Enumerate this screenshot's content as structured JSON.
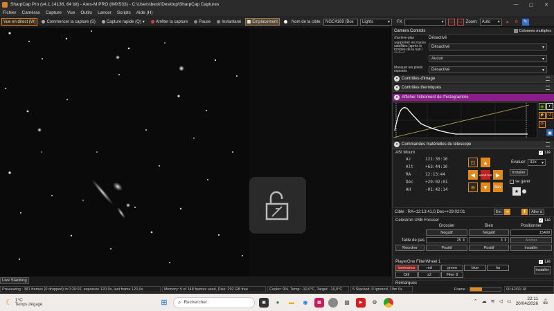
{
  "window": {
    "title": "SharpCap Pro (v4.1.14136, 64 bit) - Ares-M PRO (IMX533) - C:\\Users\\beck\\Desktop\\SharpCap Captures",
    "controls": [
      "—",
      "▢",
      "✕"
    ]
  },
  "menu": [
    "Fichier",
    "Caméras",
    "Capture",
    "Vue",
    "Outils",
    "Lancer",
    "Scripts",
    "Aide (H)"
  ],
  "toolbar": {
    "live_view": "Vue en direct (W)",
    "start_capture": "Commencer la capture (S)",
    "quick_capture": "Capture rapide (Q)",
    "stop_capture": "Arrêter la capture",
    "pause": "Pause",
    "snapshot": "Instantané",
    "placement": "Emplacement",
    "target_label": "Nom de la cible:",
    "target_value": "NGC4169 (Box",
    "frame_type": "Lights",
    "fx_label": "FX",
    "zoom_label": "Zoom:",
    "zoom_value": "Auto"
  },
  "image": {
    "lock_icon": "unlock-icon",
    "live_stacking": "Live Stacking"
  },
  "status": {
    "previewing": "Previewing : 381 frames (0 dropped) in 0:26:02, exposure 120,0s, last frame 120,0s",
    "memory": "Memory: 5 of 148 frames used, Disk: 292 GB free",
    "cooler": "Cooler: 9%, Temp: -10,0°C, Target: -10,0°C",
    "stacked": "5 Stacked, 0 Ignored, 10m 0s",
    "frame_label": "Frame :",
    "time": "00:42/01:18"
  },
  "panel": {
    "camera_controls": "Camera Controls",
    "multi_columns": "Colonnes multiples",
    "cc_rows": [
      {
        "label": "d'arrière-plan",
        "value": "Désactivé"
      },
      {
        "label": "Supprimer les traces satellites (après le tombée de la nuit / étoiles)",
        "value": "Désactivé"
      },
      {
        "label": "",
        "value": "Aucun"
      },
      {
        "label": "Masquer les pixels exposés",
        "value": "Désactivé"
      }
    ],
    "image_controls": "Contrôles d'image",
    "thermal_controls": "Contrôles thermiques",
    "histogram_title": "Afficher l'étirement de l'histogramme",
    "scope_section": "Commandes matérielles du télescope",
    "mount_name": "ASI Mount",
    "linked": "Lié",
    "coords": [
      {
        "k": "Az",
        "v": "121:30:16"
      },
      {
        "k": "Alt",
        "v": "+63:44:10"
      },
      {
        "k": "RA",
        "v": "12:13:44"
      },
      {
        "k": "Déc",
        "v": "+29:02:01"
      },
      {
        "k": "AH",
        "v": "-01:42:14"
      }
    ],
    "speed_label": "Évaluer:",
    "speed_value": "32x",
    "install": "Installer",
    "park": "se garer",
    "stop": "ARRÊTER",
    "follow": "Suiv",
    "target_line": "Cible : RA=12:13:41,0,Dec=+29:02:01",
    "goto_btn": "Em",
    "goto2_btn": "Aller à",
    "focuser_name": "Celestron USB Focuser",
    "focus_coarse": "Grossier",
    "focus_fine": "Bien",
    "focus_position": "Positionner",
    "negative": "Négatif",
    "positive": "Positif",
    "step_label": "Taille de pas",
    "coarse_step": "25",
    "fine_step": "3",
    "position_value": "15499",
    "stop_btn": "Arrêter",
    "reverse": "Reordrer",
    "wheel_name": "PlayerOne FilterWheel 1",
    "filters_row1": [
      "luminance",
      "red",
      "green",
      "blue",
      "ha"
    ],
    "filters_row2": [
      "OIII",
      "s2",
      "Filter 8"
    ],
    "wheel_install": "Installer",
    "remarks": "Remarques"
  },
  "taskbar": {
    "weather_temp": "1°C",
    "weather_text": "Temps dégagé",
    "search_placeholder": "Rechercher",
    "time": "22:11",
    "date": "20/04/2026"
  }
}
